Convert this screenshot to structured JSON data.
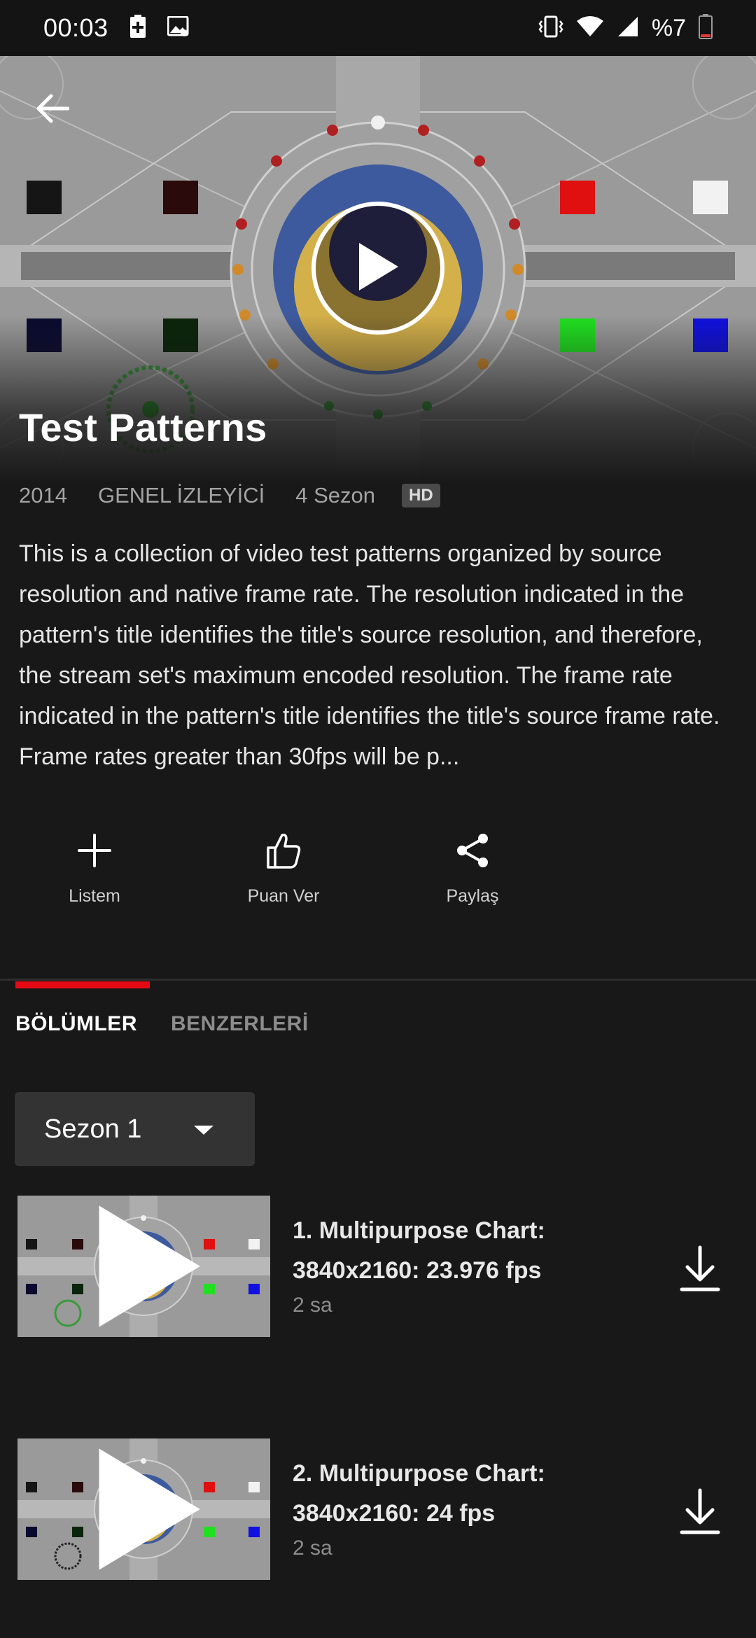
{
  "status_bar": {
    "time": "00:03",
    "battery_text": "%7",
    "icons": [
      "sim-plus-icon",
      "image-notification-icon",
      "vibrate-icon",
      "wifi-icon",
      "signal-icon",
      "battery-icon"
    ]
  },
  "hero": {
    "title": "Test Patterns",
    "icons": [
      "back-arrow-icon",
      "play-icon"
    ]
  },
  "meta": {
    "year": "2014",
    "rating": "GENEL İZLEYİCİ",
    "seasons": "4 Sezon",
    "quality_badge": "HD"
  },
  "description": "This is a collection of video test patterns organized by source resolution and native frame rate. The resolution indicated in the pattern's title identifies the title's source resolution, and therefore, the stream set's maximum encoded resolution. The frame rate indicated in the pattern's title identifies the title's source frame rate. Frame rates greater than 30fps will be p...",
  "actions": [
    {
      "label": "Listem",
      "icon": "plus-icon"
    },
    {
      "label": "Puan Ver",
      "icon": "thumbs-up-icon"
    },
    {
      "label": "Paylaş",
      "icon": "share-icon"
    }
  ],
  "tabs": [
    {
      "label": "BÖLÜMLER",
      "active": true
    },
    {
      "label": "BENZERLERİ",
      "active": false
    }
  ],
  "season_select": {
    "selected": "Sezon 1"
  },
  "episodes": [
    {
      "title": "1. Multipurpose Chart: 3840x2160: 23.976 fps",
      "duration": "2 sa"
    },
    {
      "title": "2. Multipurpose Chart: 3840x2160: 24 fps",
      "duration": "2 sa"
    }
  ],
  "colors": {
    "background": "#181818",
    "accent": "#e50914",
    "tab_inactive": "#8c8c8c"
  }
}
